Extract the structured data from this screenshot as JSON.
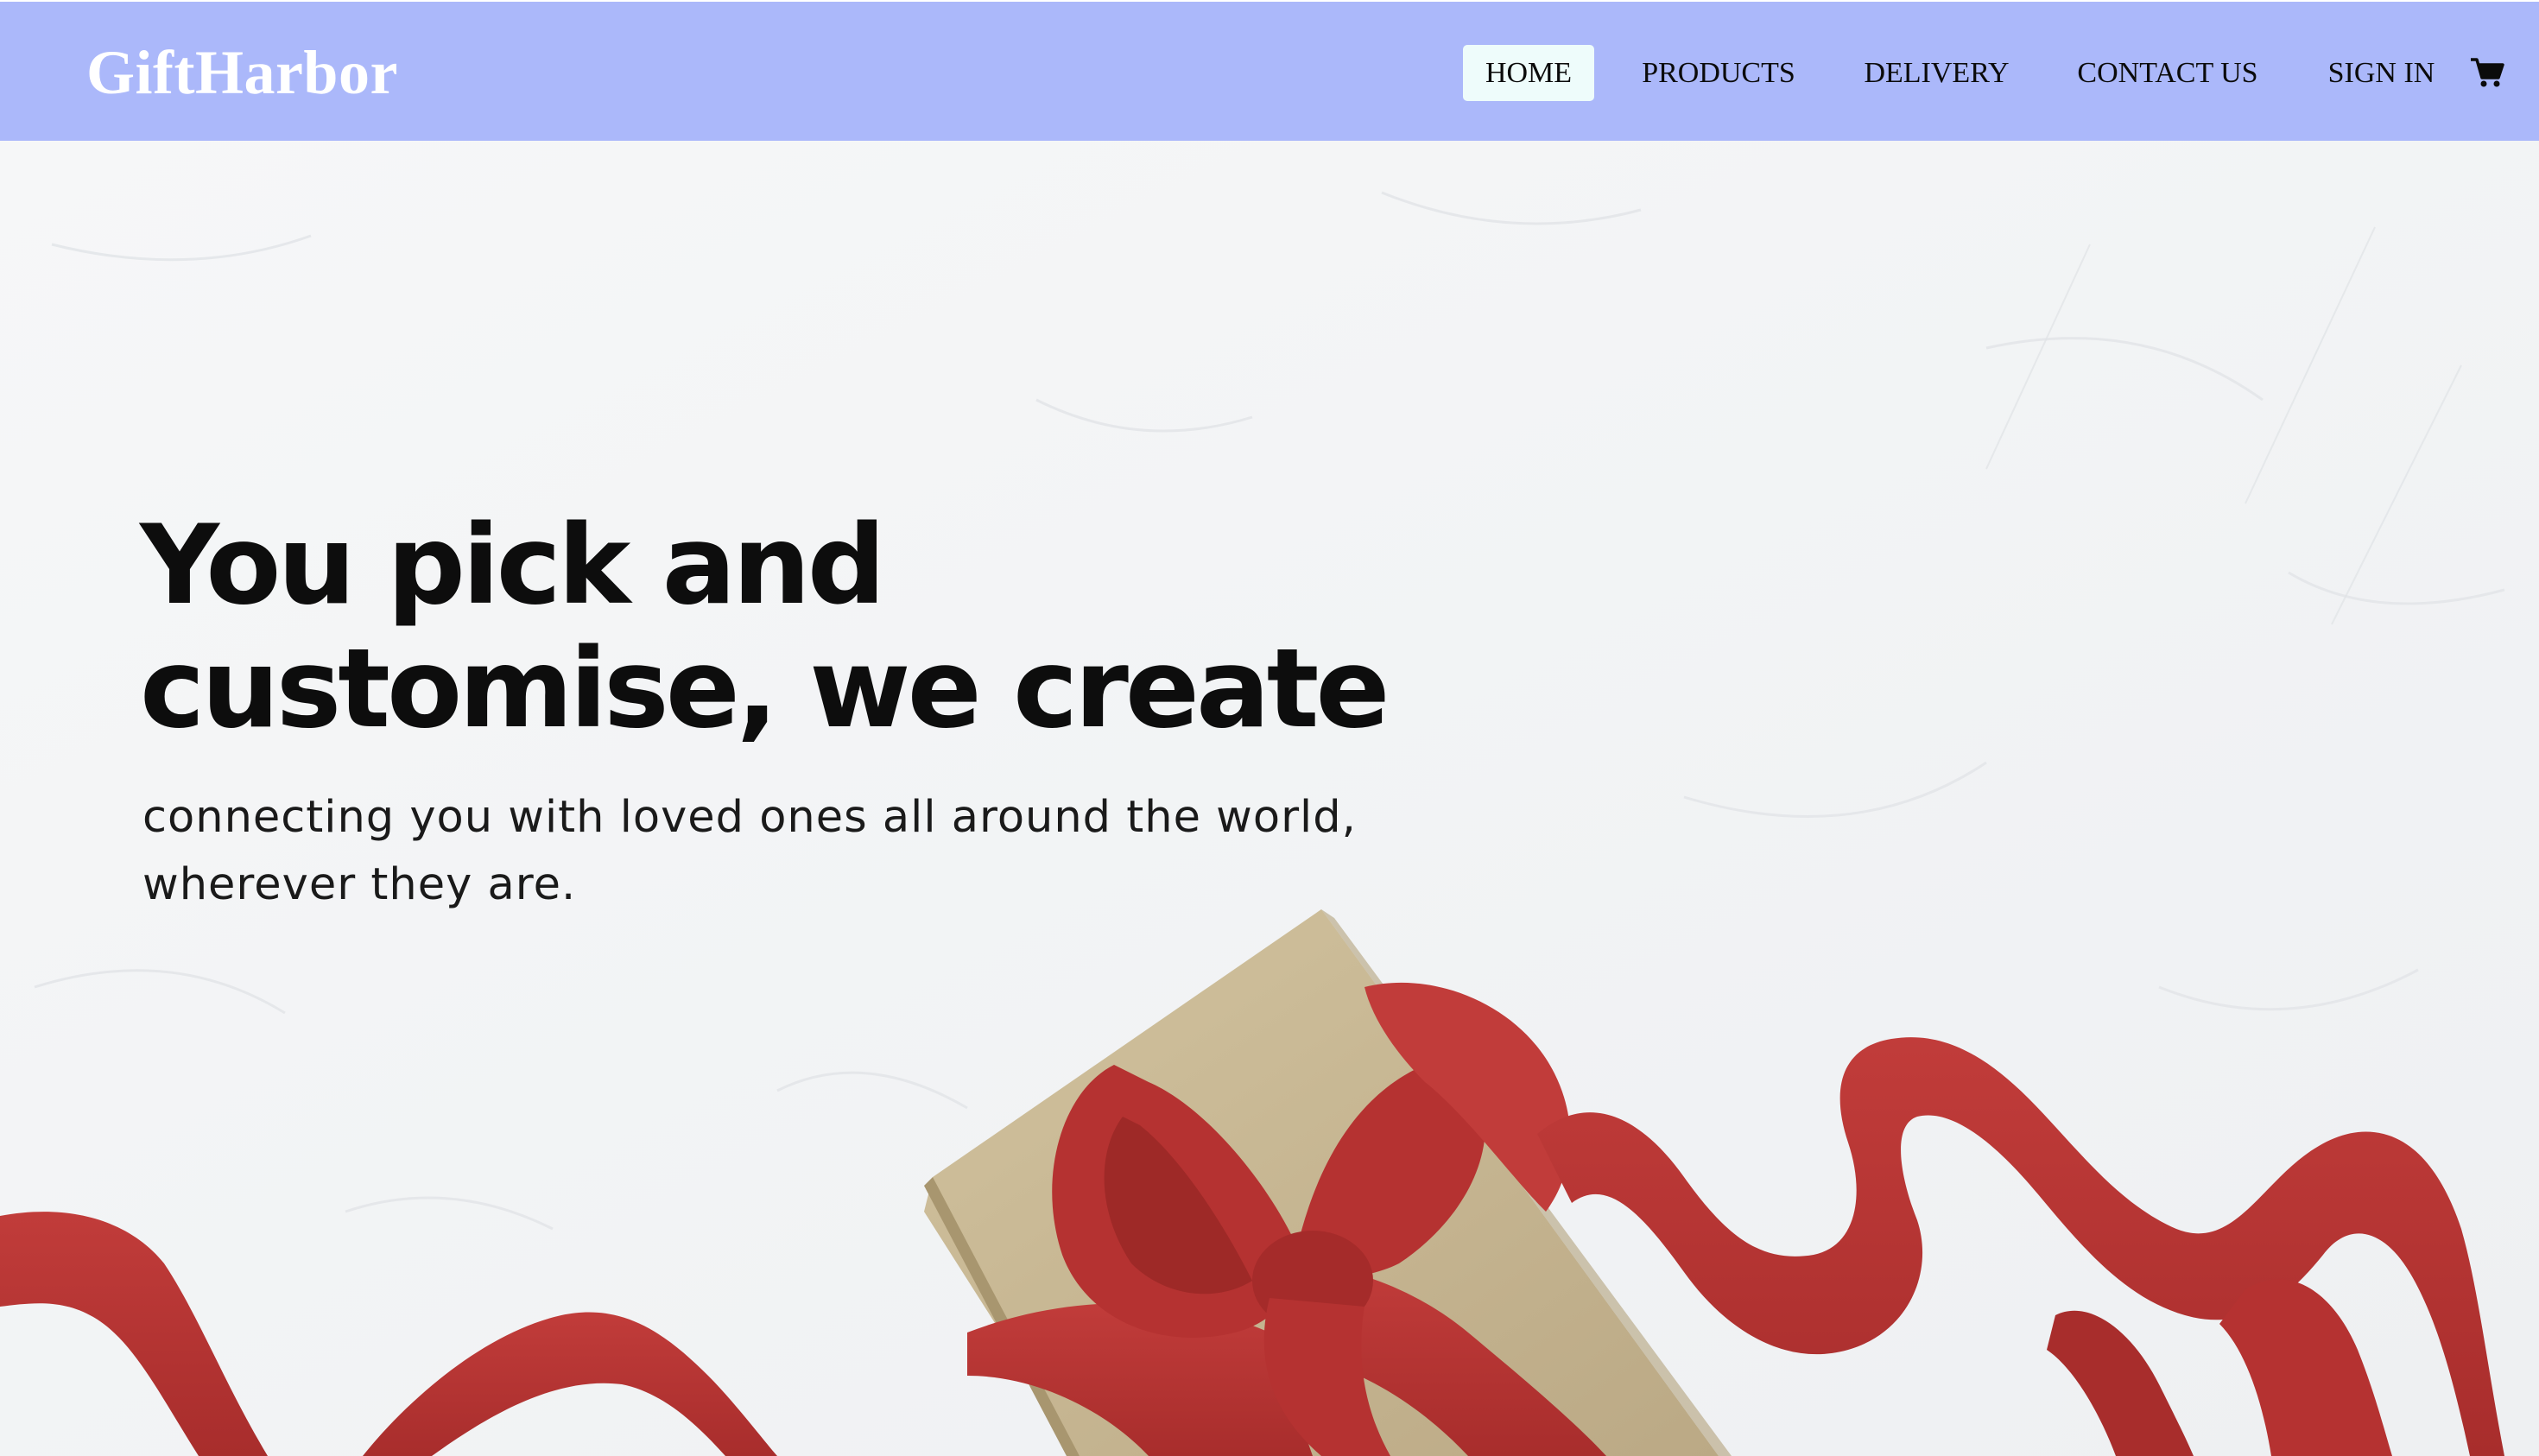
{
  "brand": {
    "name": "GiftHarbor"
  },
  "nav": {
    "items": [
      {
        "label": "HOME",
        "active": true
      },
      {
        "label": "PRODUCTS",
        "active": false
      },
      {
        "label": "DELIVERY",
        "active": false
      },
      {
        "label": "CONTACT US",
        "active": false
      },
      {
        "label": "SIGN IN",
        "active": false
      }
    ],
    "cart_icon": "shopping-cart-icon"
  },
  "hero": {
    "headline": "You pick and customise, we create",
    "subheadline": "connecting you with loved ones all around the world, wherever they are.",
    "image": "gift-box-with-red-ribbon"
  },
  "colors": {
    "nav_background": "#abb8fa",
    "active_tab_background": "#eefcfb",
    "logo_text": "#ffffff",
    "ribbon_red": "#b73332",
    "box_kraft": "#c9b892"
  }
}
